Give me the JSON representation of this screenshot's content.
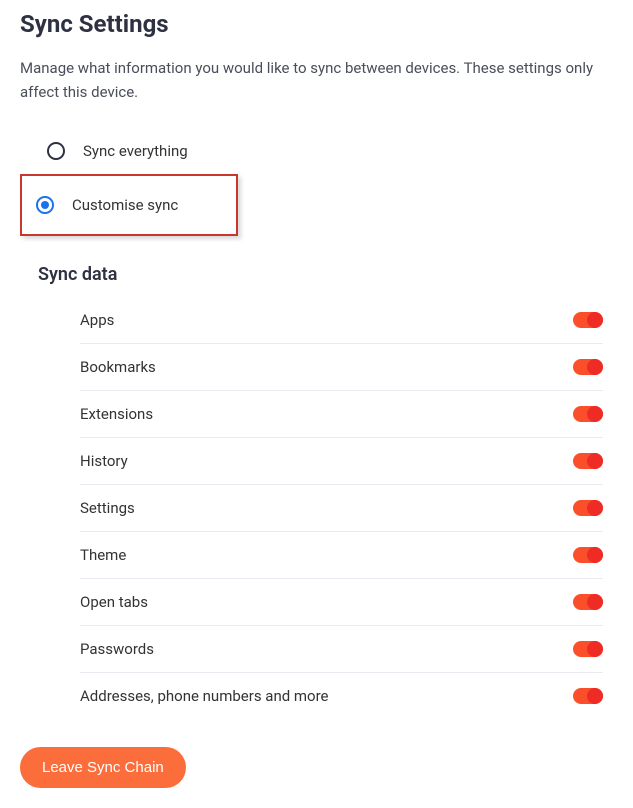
{
  "header": {
    "title": "Sync Settings",
    "description": "Manage what information you would like to sync between devices. These settings only affect this device."
  },
  "radios": {
    "option_everything": "Sync everything",
    "option_customise": "Customise sync",
    "selected": "customise"
  },
  "sync_data_section": {
    "title": "Sync data",
    "items": [
      {
        "label": "Apps",
        "enabled": true
      },
      {
        "label": "Bookmarks",
        "enabled": true
      },
      {
        "label": "Extensions",
        "enabled": true
      },
      {
        "label": "History",
        "enabled": true
      },
      {
        "label": "Settings",
        "enabled": true
      },
      {
        "label": "Theme",
        "enabled": true
      },
      {
        "label": "Open tabs",
        "enabled": true
      },
      {
        "label": "Passwords",
        "enabled": true
      },
      {
        "label": "Addresses, phone numbers and more",
        "enabled": true
      }
    ]
  },
  "actions": {
    "leave_label": "Leave Sync Chain"
  }
}
